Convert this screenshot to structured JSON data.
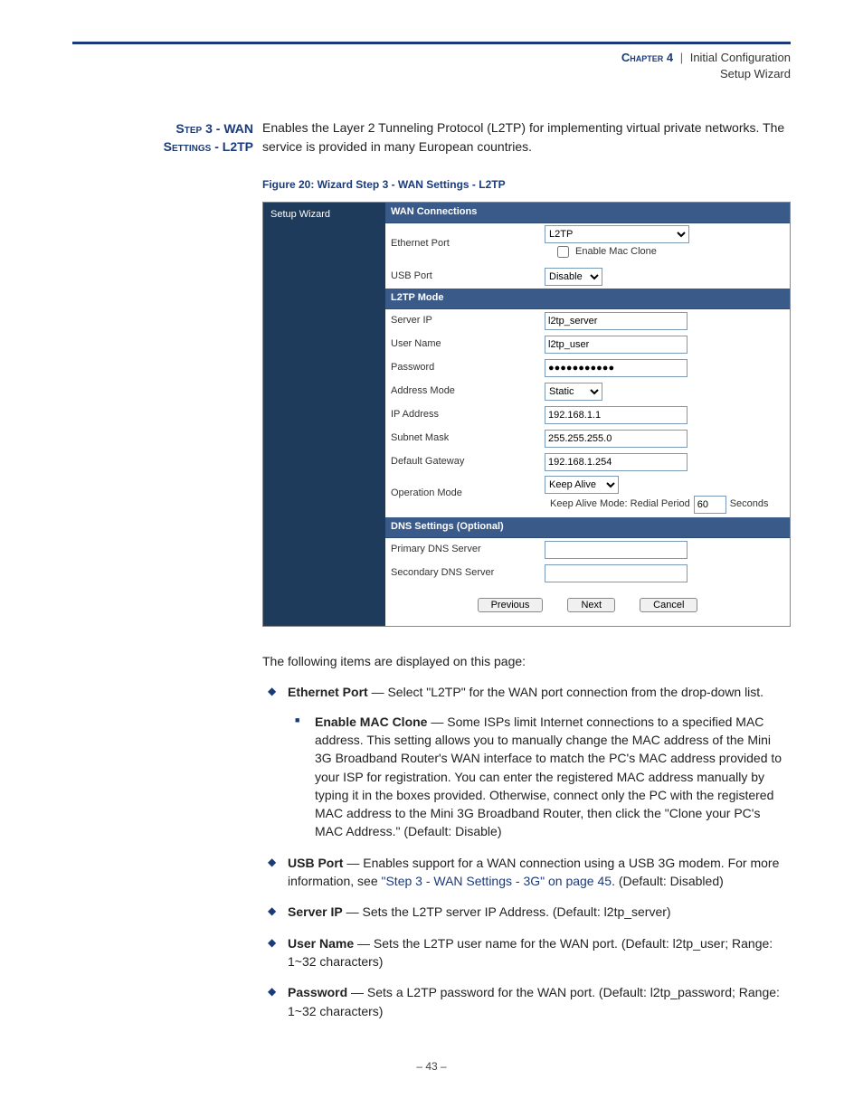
{
  "header": {
    "chapter": "Chapter 4",
    "sep": "|",
    "title": "Initial Configuration",
    "subtitle": "Setup Wizard"
  },
  "section_label_line1": "Step 3 - WAN",
  "section_label_line2": "Settings - L2TP",
  "intro": "Enables the Layer 2 Tunneling Protocol (L2TP) for implementing virtual private networks. The service is provided in many European countries.",
  "figure_caption": "Figure 20:  Wizard Step 3 - WAN Settings - L2TP",
  "screenshot": {
    "sidebar_title": "Setup Wizard",
    "sections": {
      "wan": {
        "title": "WAN Connections",
        "ethernet_port_label": "Ethernet Port",
        "ethernet_port_value": "L2TP",
        "enable_mac_label": "Enable Mac Clone",
        "usb_port_label": "USB Port",
        "usb_port_value": "Disable"
      },
      "l2tp": {
        "title": "L2TP Mode",
        "server_ip_label": "Server IP",
        "server_ip_value": "l2tp_server",
        "username_label": "User Name",
        "username_value": "l2tp_user",
        "password_label": "Password",
        "password_value": "●●●●●●●●●●●",
        "address_mode_label": "Address Mode",
        "address_mode_value": "Static",
        "ip_label": "IP Address",
        "ip_value": "192.168.1.1",
        "subnet_label": "Subnet Mask",
        "subnet_value": "255.255.255.0",
        "gateway_label": "Default Gateway",
        "gateway_value": "192.168.1.254",
        "op_mode_label": "Operation Mode",
        "op_mode_value": "Keep Alive",
        "keepalive_prefix": "Keep Alive Mode: Redial Period",
        "keepalive_value": "60",
        "keepalive_suffix": "Seconds"
      },
      "dns": {
        "title": "DNS Settings (Optional)",
        "primary_label": "Primary DNS Server",
        "secondary_label": "Secondary DNS Server"
      }
    },
    "buttons": {
      "previous": "Previous",
      "next": "Next",
      "cancel": "Cancel"
    }
  },
  "desc_intro": "The following items are displayed on this page:",
  "items": {
    "ethernet_term": "Ethernet Port",
    "ethernet_desc": " — Select \"L2TP\" for the WAN port connection from the drop-down list.",
    "mac_term": "Enable MAC Clone",
    "mac_desc": " — Some ISPs limit Internet connections to a specified MAC address. This setting allows you to manually change the MAC address of the Mini 3G Broadband Router's WAN interface to match the PC's MAC address provided to your ISP for registration. You can enter the registered MAC address manually by typing it in the boxes provided. Otherwise, connect only the PC with the registered MAC address to the Mini 3G Broadband Router, then click the \"Clone your PC's MAC Address.\" (Default: Disable)",
    "usb_term": "USB Port",
    "usb_desc_pre": " — Enables support for a WAN connection using a USB 3G modem. For more information, see ",
    "usb_link": "\"Step 3 - WAN Settings - 3G\" on page 45",
    "usb_desc_post": ". (Default: Disabled)",
    "server_term": "Server IP",
    "server_desc": " — Sets the L2TP server IP Address. (Default: l2tp_server)",
    "user_term": "User Name",
    "user_desc": " — Sets the L2TP user name for the WAN port. (Default: l2tp_user; Range: 1~32 characters)",
    "pass_term": "Password",
    "pass_desc": " — Sets a L2TP password for the WAN port. (Default: l2tp_password; Range: 1~32 characters)"
  },
  "page_number": "–  43  –"
}
